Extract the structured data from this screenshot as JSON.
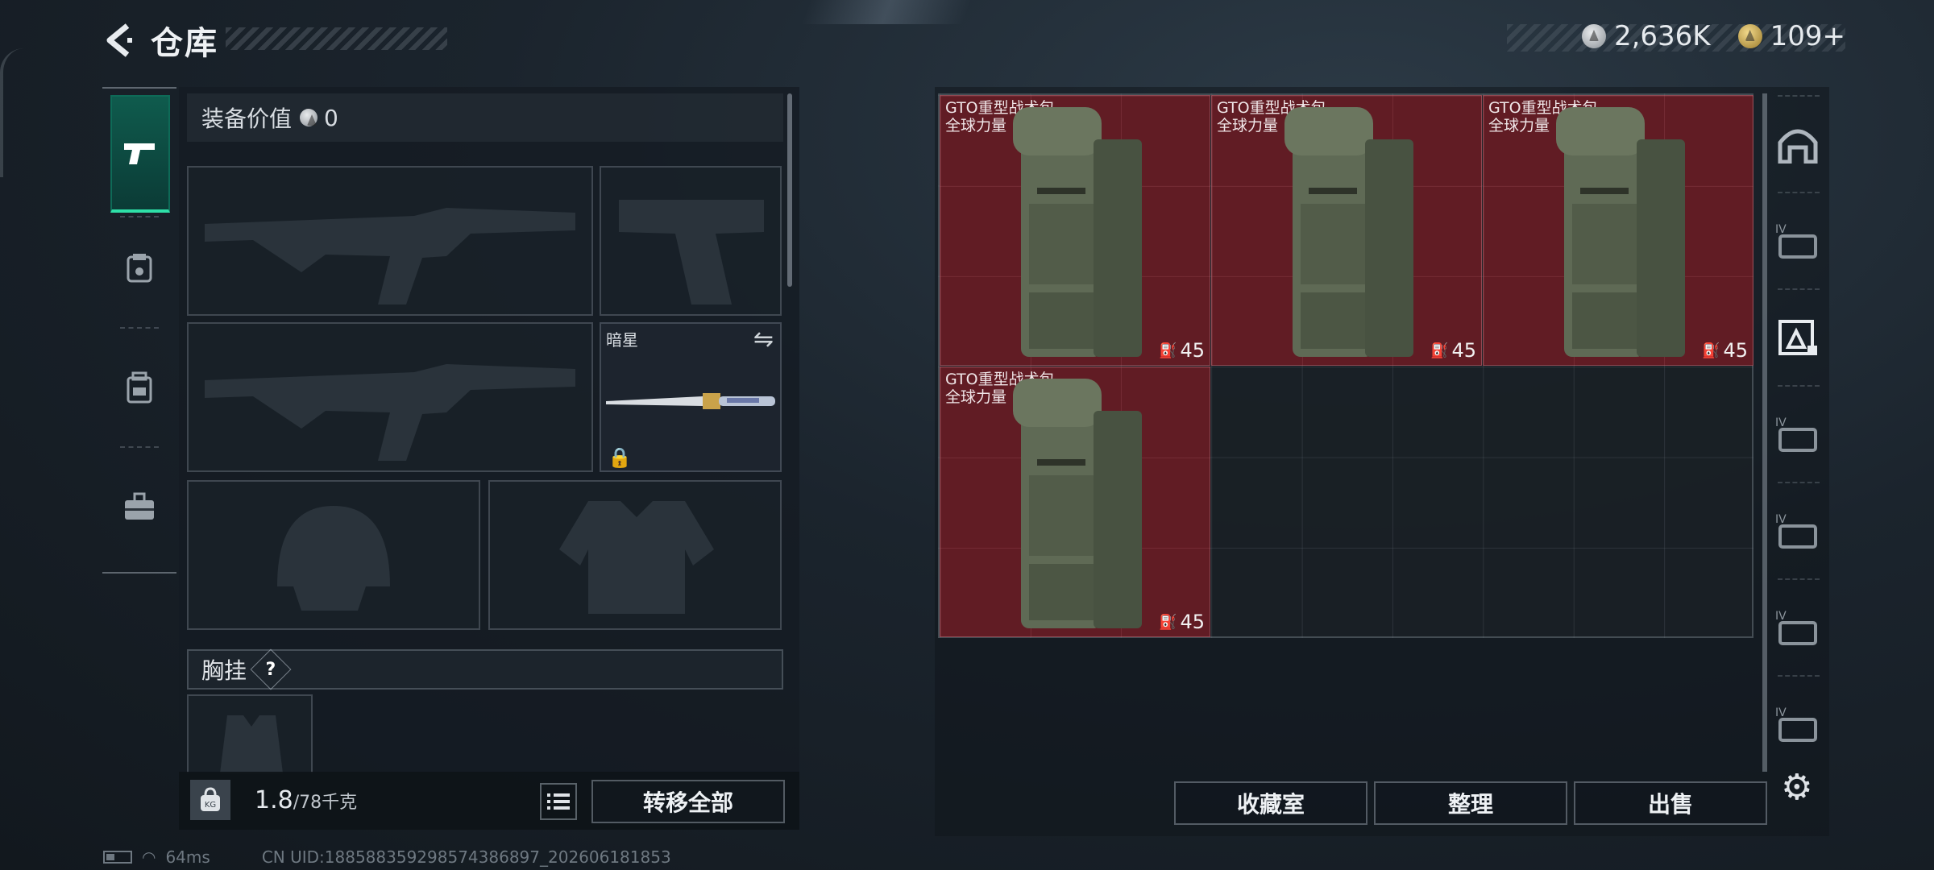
{
  "header": {
    "back": "<",
    "title": "仓库"
  },
  "currency": {
    "silver": "2,636K",
    "gold": "109+",
    "small_code": ""
  },
  "equip": {
    "value_label": "装备价值",
    "value": "0",
    "melee_name": "暗星",
    "chest_label": "胸挂",
    "help": "?"
  },
  "weight": {
    "current": "1.8",
    "max": "/78千克",
    "icon": "KG"
  },
  "buttons": {
    "transfer_all": "转移全部",
    "collection": "收藏室",
    "sort": "整理",
    "sell": "出售"
  },
  "items": [
    {
      "name1": "GTO重型战术包",
      "name2": "全球力量",
      "count": "45"
    },
    {
      "name1": "GTO重型战术包",
      "name2": "全球力量",
      "count": "45"
    },
    {
      "name1": "GTO重型战术包",
      "name2": "全球力量",
      "count": "45"
    },
    {
      "name1": "GTO重型战术包",
      "name2": "全球力量",
      "count": "45"
    }
  ],
  "status": {
    "ping": "64ms",
    "uid": "CN UID:1885883592985743868​97_202606181853"
  },
  "right_tabs": [
    "home-icon",
    "container-IV-icon",
    "backpack-storage-icon",
    "container-IV-icon",
    "container-IV-icon",
    "container-IV-icon",
    "container-IV-icon"
  ],
  "colors": {
    "accent": "#2ee0a8",
    "item_bg": "#6e1c24"
  }
}
